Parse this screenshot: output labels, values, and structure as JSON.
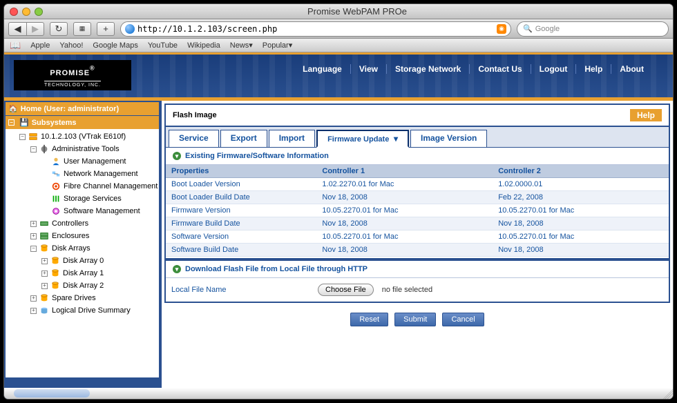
{
  "window": {
    "title": "Promise WebPAM PROe"
  },
  "browser": {
    "url": "http://10.1.2.103/screen.php",
    "search_placeholder": "Google",
    "bookmarks": [
      "Apple",
      "Yahoo!",
      "Google Maps",
      "YouTube",
      "Wikipedia",
      "News▾",
      "Popular▾"
    ]
  },
  "brand": {
    "name": "PROMISE",
    "sub": "TECHNOLOGY, INC.",
    "reg": "®"
  },
  "topnav": [
    "Language",
    "View",
    "Storage Network",
    "Contact Us",
    "Logout",
    "Help",
    "About"
  ],
  "tree": {
    "home": "Home (User: administrator)",
    "subsystems": "Subsystems",
    "root": "10.1.2.103 (VTrak E610f)",
    "items": [
      {
        "indent": 1,
        "exp": "-",
        "icon": "server",
        "label": "10.1.2.103 (VTrak E610f)"
      },
      {
        "indent": 2,
        "exp": "-",
        "icon": "tools",
        "label": "Administrative Tools"
      },
      {
        "indent": 3,
        "exp": "",
        "icon": "user",
        "label": "User Management"
      },
      {
        "indent": 3,
        "exp": "",
        "icon": "net",
        "label": "Network Management"
      },
      {
        "indent": 3,
        "exp": "",
        "icon": "fc",
        "label": "Fibre Channel Management"
      },
      {
        "indent": 3,
        "exp": "",
        "icon": "svc",
        "label": "Storage Services"
      },
      {
        "indent": 3,
        "exp": "",
        "icon": "sw",
        "label": "Software Management"
      },
      {
        "indent": 2,
        "exp": "+",
        "icon": "ctrl",
        "label": "Controllers"
      },
      {
        "indent": 2,
        "exp": "+",
        "icon": "enc",
        "label": "Enclosures"
      },
      {
        "indent": 2,
        "exp": "-",
        "icon": "disk",
        "label": "Disk Arrays"
      },
      {
        "indent": 3,
        "exp": "+",
        "icon": "disk",
        "label": "Disk Array 0"
      },
      {
        "indent": 3,
        "exp": "+",
        "icon": "disk",
        "label": "Disk Array 1"
      },
      {
        "indent": 3,
        "exp": "+",
        "icon": "disk",
        "label": "Disk Array 2"
      },
      {
        "indent": 2,
        "exp": "+",
        "icon": "disk",
        "label": "Spare Drives"
      },
      {
        "indent": 2,
        "exp": "+",
        "icon": "ld",
        "label": "Logical Drive Summary"
      }
    ]
  },
  "panel": {
    "title": "Flash Image",
    "help": "Help",
    "tabs": [
      "Service",
      "Export",
      "Import",
      "Firmware Update",
      "Image Version"
    ],
    "active_tab": 3,
    "section1": "Existing Firmware/Software Information",
    "columns": [
      "Properties",
      "Controller 1",
      "Controller 2"
    ],
    "rows": [
      [
        "Boot Loader Version",
        "1.02.2270.01 for Mac",
        "1.02.0000.01"
      ],
      [
        "Boot Loader Build Date",
        "Nov 18, 2008",
        "Feb 22, 2008"
      ],
      [
        "Firmware Version",
        "10.05.2270.01 for Mac",
        "10.05.2270.01 for Mac"
      ],
      [
        "Firmware Build Date",
        "Nov 18, 2008",
        "Nov 18, 2008"
      ],
      [
        "Software Version",
        "10.05.2270.01 for Mac",
        "10.05.2270.01 for Mac"
      ],
      [
        "Software Build Date",
        "Nov 18, 2008",
        "Nov 18, 2008"
      ]
    ],
    "section2": "Download Flash File from Local File through HTTP",
    "local_file_label": "Local File Name",
    "choose_file": "Choose File",
    "no_file": "no file selected",
    "buttons": [
      "Reset",
      "Submit",
      "Cancel"
    ]
  }
}
